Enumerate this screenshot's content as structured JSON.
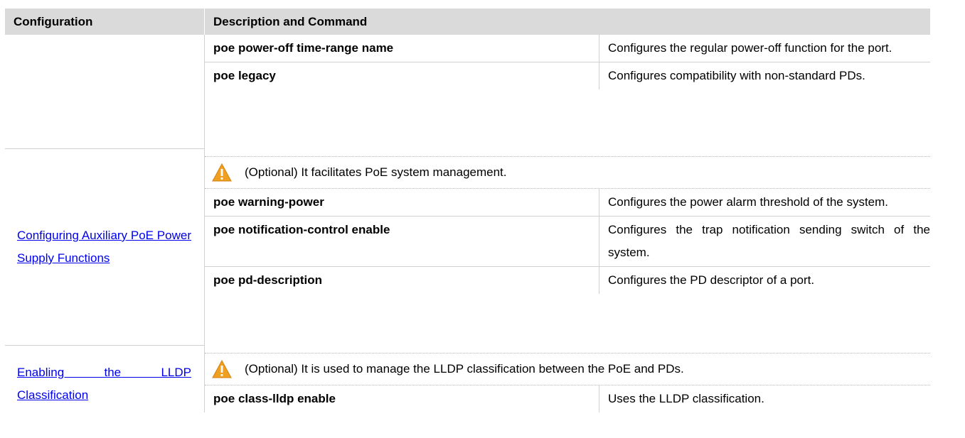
{
  "table": {
    "headers": {
      "configuration": "Configuration",
      "description": "Description and Command"
    },
    "group1": {
      "rows": [
        {
          "command": "poe power-off time-range name",
          "description": "Configures the regular power-off function for the port."
        },
        {
          "command": "poe legacy",
          "description": "Configures compatibility with non-standard PDs."
        }
      ]
    },
    "group2": {
      "link": "Configuring Auxiliary PoE Power Supply Functions",
      "note": "(Optional) It facilitates PoE system management.",
      "rows": [
        {
          "command": "poe warning-power",
          "description": "Configures the power alarm threshold of the system."
        },
        {
          "command": "poe notification-control enable",
          "description": "Configures the trap notification sending switch of the system."
        },
        {
          "command": "poe pd-description",
          "description": "Configures the PD descriptor of a port."
        }
      ]
    },
    "group3": {
      "link": "Enabling the LLDP Classification",
      "note": "(Optional) It is used to manage the LLDP classification between the PoE and PDs.",
      "rows": [
        {
          "command": "poe class-lldp enable",
          "description": "Uses the LLDP classification."
        }
      ]
    }
  },
  "icons": {
    "note_icon": "warning-icon",
    "warning_fill": "#f0a020",
    "link_color": "#0000ee",
    "header_bg": "#dadada"
  }
}
